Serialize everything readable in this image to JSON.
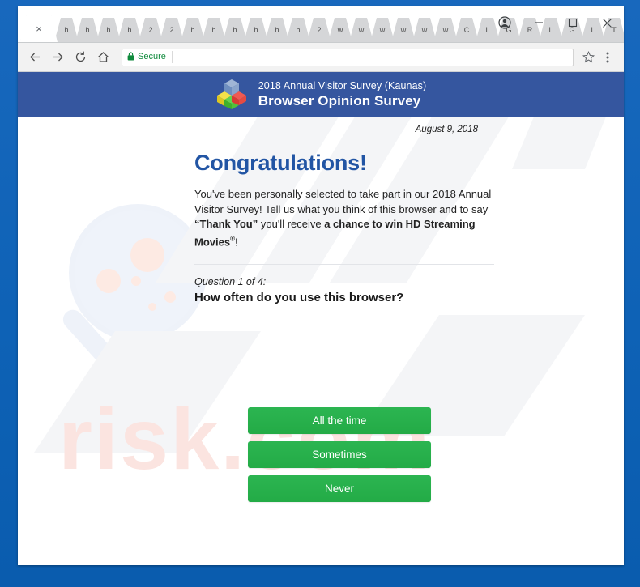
{
  "browser": {
    "tabs": [
      {
        "label": "×",
        "active": true,
        "name": "tab-active"
      },
      {
        "label": "h",
        "active": false
      },
      {
        "label": "h",
        "active": false
      },
      {
        "label": "h",
        "active": false
      },
      {
        "label": "h",
        "active": false
      },
      {
        "label": "2",
        "active": false
      },
      {
        "label": "2",
        "active": false
      },
      {
        "label": "h",
        "active": false
      },
      {
        "label": "h",
        "active": false
      },
      {
        "label": "h",
        "active": false
      },
      {
        "label": "h",
        "active": false
      },
      {
        "label": "h",
        "active": false
      },
      {
        "label": "h",
        "active": false
      },
      {
        "label": "2",
        "active": false
      },
      {
        "label": "w",
        "active": false
      },
      {
        "label": "w",
        "active": false
      },
      {
        "label": "w",
        "active": false
      },
      {
        "label": "w",
        "active": false
      },
      {
        "label": "w",
        "active": false
      },
      {
        "label": "w",
        "active": false
      },
      {
        "label": "C",
        "active": false
      },
      {
        "label": "L",
        "active": false
      },
      {
        "label": "G",
        "active": false
      },
      {
        "label": "R",
        "active": false
      },
      {
        "label": "L",
        "active": false
      },
      {
        "label": "G",
        "active": false
      },
      {
        "label": "L",
        "active": false
      },
      {
        "label": "T",
        "active": false
      }
    ],
    "window_controls": {
      "profile": "profile-avatar-icon",
      "minimize": "minimize-icon",
      "maximize": "maximize-icon",
      "close": "close-icon"
    },
    "toolbar": {
      "back": "back-arrow-icon",
      "forward": "forward-arrow-icon",
      "reload": "reload-icon",
      "home": "home-icon",
      "security_label": "Secure",
      "security_icon": "lock-icon",
      "url_value": "",
      "url_placeholder": "",
      "bookmark": "star-icon",
      "menu": "three-dot-menu-icon"
    }
  },
  "survey": {
    "header": {
      "logo": "colored-cubes-logo",
      "subtitle": "2018 Annual Visitor Survey (Kaunas)",
      "title": "Browser Opinion Survey"
    },
    "date": "August 9, 2018",
    "congratulations": "Congratulations!",
    "intro": {
      "part1": "You've been personally selected to take part in our 2018 Annual Visitor Survey! Tell us what you think of this browser and to say ",
      "bold1": "“Thank You”",
      "part2": " you'll receive ",
      "bold2": "a chance to win HD Streaming Movies",
      "registered": "®",
      "part3": "!"
    },
    "question_label": "Question 1 of 4:",
    "question_text": "How often do you use this browser?",
    "answers": [
      "All the time",
      "Sometimes",
      "Never"
    ]
  },
  "watermark": {
    "text": "risk.com",
    "magnifier": "magnifying-glass-watermark"
  },
  "colors": {
    "frame_blue": "#0d60b4",
    "header_blue": "#35569f",
    "heading_blue": "#2255a4",
    "button_green": "#23ab46",
    "secure_green": "#0f8a3c"
  }
}
